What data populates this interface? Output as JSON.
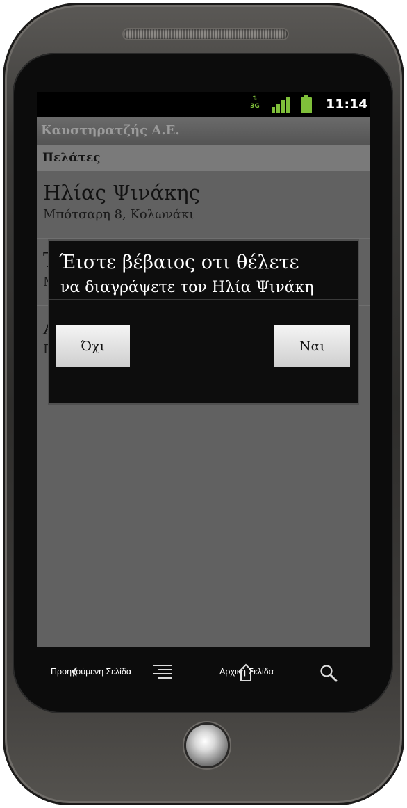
{
  "status_bar": {
    "network_label": "3G",
    "time": "11:14",
    "accent_color": "#7fbf3a",
    "icons": [
      "network-3g-icon",
      "signal-icon",
      "battery-icon"
    ]
  },
  "app": {
    "title": "Καυστηρατζής Α.Ε."
  },
  "section": {
    "header": "Πελάτες"
  },
  "customers": [
    {
      "name": "Ηλίας Ψινάκης",
      "address": "Μπότσαρη 8, Κολωνάκι"
    },
    {
      "name": "Τ",
      "address": "Μ"
    },
    {
      "name": "Α",
      "address": "Π"
    }
  ],
  "dialog": {
    "line1": "Έιστε βέβαιος οτι θέλετε",
    "line2": "να διαγράψετε τον Ηλία Ψινάκη",
    "no_label": "Όχι",
    "yes_label": "Ναι"
  },
  "navbar": {
    "back_label": "Προηγούμενη Σελίδα",
    "home_label": "Αρχική Σελίδα",
    "icons": [
      "back-icon",
      "menu-icon",
      "home-icon",
      "search-icon"
    ]
  }
}
